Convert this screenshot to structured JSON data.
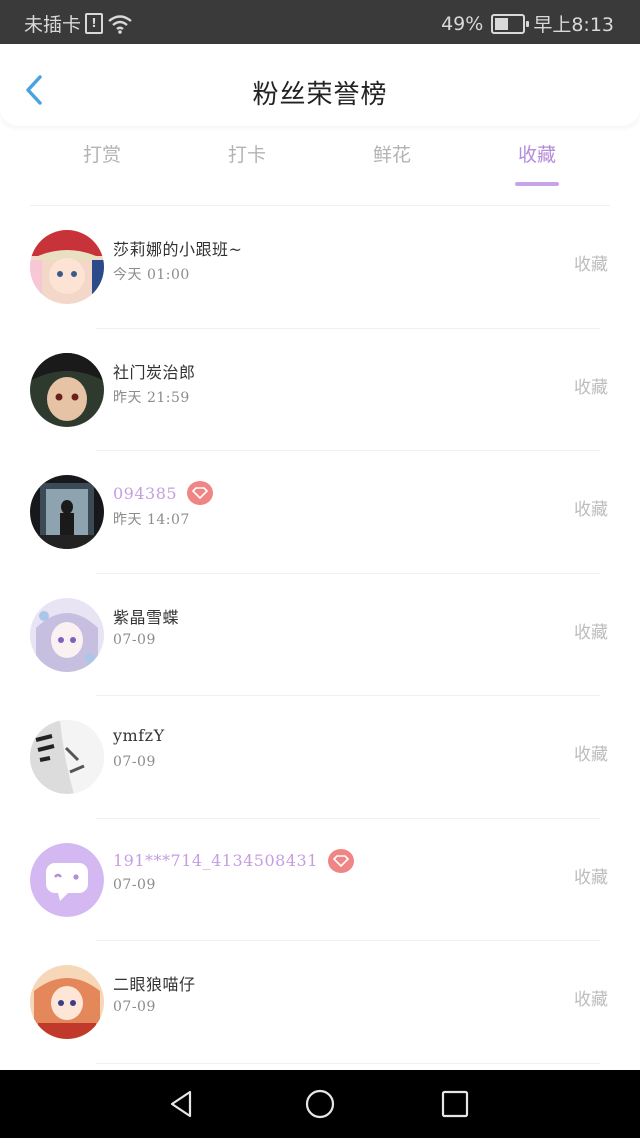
{
  "status_bar": {
    "carrier": "未插卡",
    "sim_icon": "!",
    "wifi_icon": "wifi-icon",
    "battery_text": "49%",
    "battery_level": 0.49,
    "time": "早上8:13"
  },
  "header": {
    "back_icon": "back-arrow-icon",
    "title": "粉丝荣誉榜"
  },
  "tabs": [
    {
      "label": "打赏",
      "active": false
    },
    {
      "label": "打卡",
      "active": false
    },
    {
      "label": "鲜花",
      "active": false
    },
    {
      "label": "收藏",
      "active": true
    }
  ],
  "colors": {
    "accent": "#b58dd8",
    "vip_name": "#c59ee0",
    "vip_badge": "#f08585"
  },
  "fans": [
    {
      "name": "莎莉娜的小跟班~",
      "time": "今天 01:00",
      "action": "收藏",
      "vip": false
    },
    {
      "name": "社门炭治郎",
      "time": "昨天 21:59",
      "action": "收藏",
      "vip": false
    },
    {
      "name": "094385",
      "time": "昨天 14:07",
      "action": "收藏",
      "vip": true
    },
    {
      "name": "紫晶雪蝶",
      "time": "07-09",
      "action": "收藏",
      "vip": false
    },
    {
      "name": "ymfzY",
      "time": "07-09",
      "action": "收藏",
      "vip": false
    },
    {
      "name": "191***714_4134508431",
      "time": "07-09",
      "action": "收藏",
      "vip": true
    },
    {
      "name": "二眼狼喵仔",
      "time": "07-09",
      "action": "收藏",
      "vip": false
    }
  ],
  "nav_bar": {
    "back": "nav-back-icon",
    "home": "nav-home-icon",
    "recents": "nav-recents-icon"
  }
}
